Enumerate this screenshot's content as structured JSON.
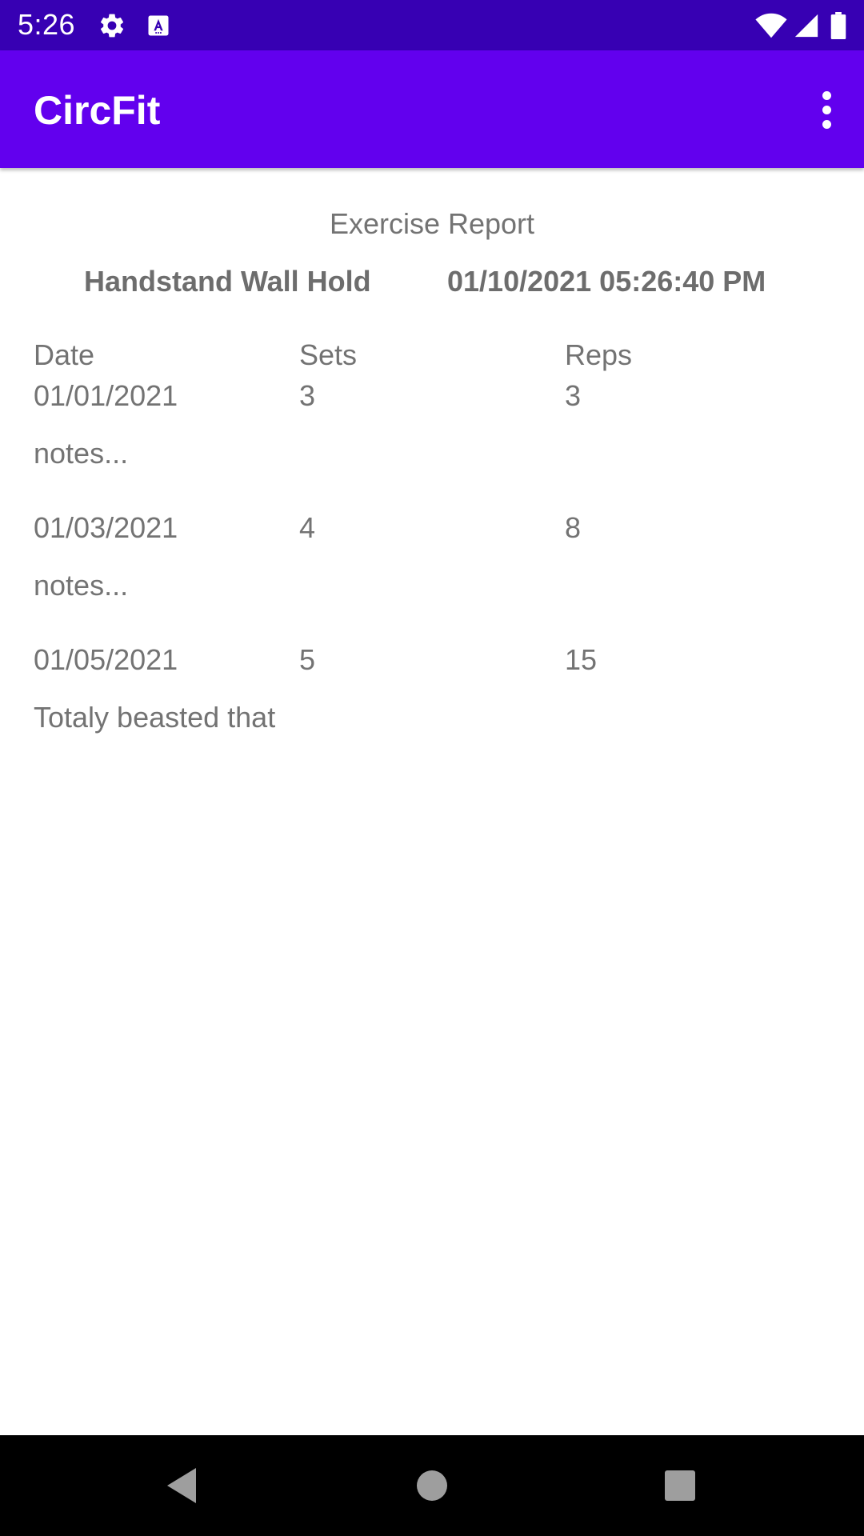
{
  "status_bar": {
    "time": "5:26",
    "icons": [
      "gear-icon",
      "text-a-icon",
      "wifi-icon",
      "signal-icon",
      "battery-icon"
    ],
    "background": "#3700b3"
  },
  "app_bar": {
    "title": "CircFit",
    "menu_icon": "more-vert-icon",
    "background": "#6200ee"
  },
  "report": {
    "title": "Exercise Report",
    "exercise_name": "Handstand Wall Hold",
    "datetime": "01/10/2021 05:26:40 PM",
    "columns": {
      "date": "Date",
      "sets": "Sets",
      "reps": "Reps"
    },
    "entries": [
      {
        "date": "01/01/2021",
        "sets": "3",
        "reps": "3",
        "note": "notes..."
      },
      {
        "date": "01/03/2021",
        "sets": "4",
        "reps": "8",
        "note": "notes..."
      },
      {
        "date": "01/05/2021",
        "sets": "5",
        "reps": "15",
        "note": "Totaly beasted that"
      }
    ]
  },
  "nav_bar": {
    "buttons": [
      "back-icon",
      "home-icon",
      "recents-icon"
    ]
  }
}
